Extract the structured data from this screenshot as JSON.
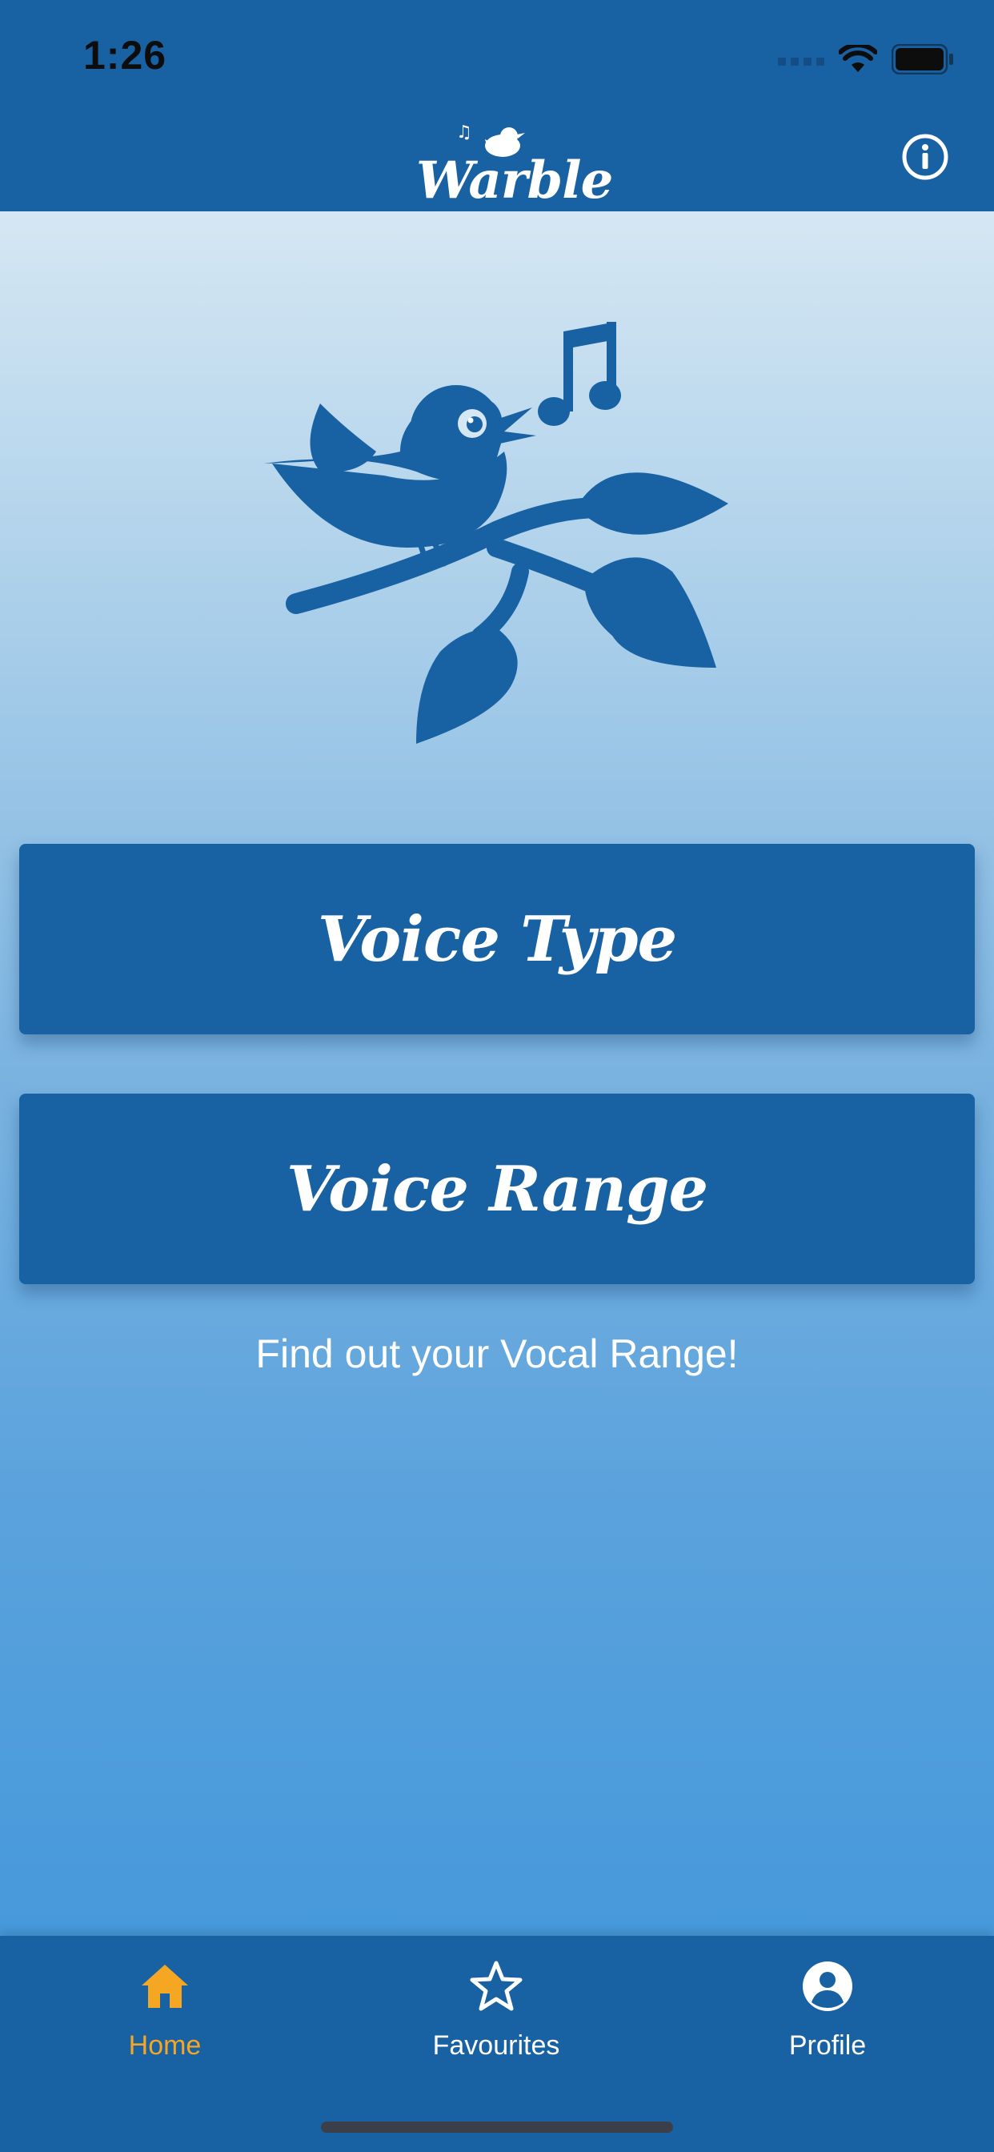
{
  "status": {
    "time": "1:26"
  },
  "header": {
    "logo_text": "Warble"
  },
  "buttons": {
    "voice_type": "Voice Type",
    "voice_range": "Voice Range"
  },
  "subtitle": "Find out your Vocal Range!",
  "tabs": [
    {
      "label": "Home",
      "icon": "home-icon",
      "active": true
    },
    {
      "label": "Favourites",
      "icon": "star-icon",
      "active": false
    },
    {
      "label": "Profile",
      "icon": "profile-icon",
      "active": false
    }
  ],
  "colors": {
    "brand": "#1861a3",
    "active_tab": "#f5a623",
    "inactive_tab": "#ffffff"
  }
}
